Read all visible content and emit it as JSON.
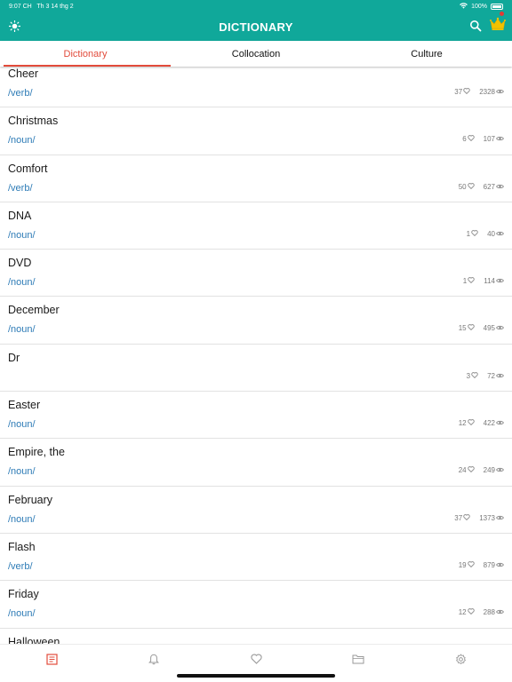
{
  "status_bar": {
    "time": "9:07 CH",
    "date": "Th 3 14 thg 2",
    "battery": "100%"
  },
  "header": {
    "title": "DICTIONARY",
    "left_icon": "sun-icon",
    "search_icon": "search-icon",
    "premium_icon": "crown-icon"
  },
  "tabs": [
    {
      "label": "Dictionary",
      "active": true
    },
    {
      "label": "Collocation",
      "active": false
    },
    {
      "label": "Culture",
      "active": false
    }
  ],
  "entries": [
    {
      "word": "Cheer",
      "pos": "/verb/",
      "likes": "37",
      "views": "2328"
    },
    {
      "word": "Christmas",
      "pos": "/noun/",
      "likes": "6",
      "views": "107"
    },
    {
      "word": "Comfort",
      "pos": "/verb/",
      "likes": "50",
      "views": "627"
    },
    {
      "word": "DNA",
      "pos": "/noun/",
      "likes": "1",
      "views": "40"
    },
    {
      "word": "DVD",
      "pos": "/noun/",
      "likes": "1",
      "views": "114"
    },
    {
      "word": "December",
      "pos": "/noun/",
      "likes": "15",
      "views": "495"
    },
    {
      "word": "Dr",
      "pos": "",
      "likes": "3",
      "views": "72"
    },
    {
      "word": "Easter",
      "pos": "/noun/",
      "likes": "12",
      "views": "422"
    },
    {
      "word": "Empire, the",
      "pos": "/noun/",
      "likes": "24",
      "views": "249"
    },
    {
      "word": "February",
      "pos": "/noun/",
      "likes": "37",
      "views": "1373"
    },
    {
      "word": "Flash",
      "pos": "/verb/",
      "likes": "19",
      "views": "879"
    },
    {
      "word": "Friday",
      "pos": "/noun/",
      "likes": "12",
      "views": "288"
    },
    {
      "word": "Halloween",
      "pos": "",
      "likes": "",
      "views": ""
    }
  ],
  "bottom_nav": [
    {
      "icon": "dictionary-icon",
      "active": true
    },
    {
      "icon": "bell-icon",
      "active": false
    },
    {
      "icon": "heart-icon",
      "active": false
    },
    {
      "icon": "folder-icon",
      "active": false
    },
    {
      "icon": "settings-icon",
      "active": false
    }
  ],
  "colors": {
    "brand": "#10a89a",
    "accent": "#e24b3b",
    "pos": "#2d7bb6",
    "crown": "#f2c200"
  }
}
